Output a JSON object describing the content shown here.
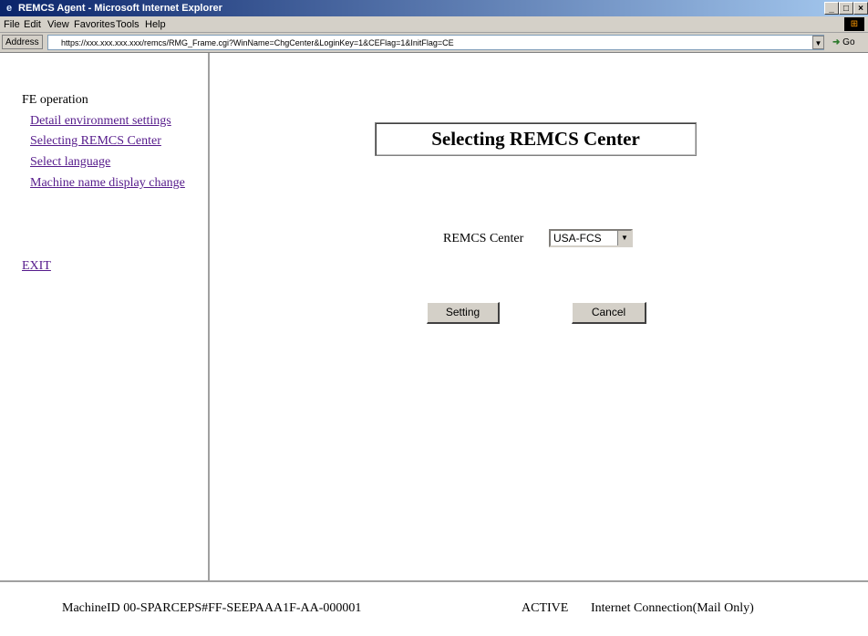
{
  "window": {
    "title": "REMCS Agent - Microsoft Internet Explorer",
    "icon": "ie-icon",
    "minimize": "_",
    "maximize": "□",
    "close": "×"
  },
  "menu": [
    "File",
    "Edit",
    "View",
    "Favorites",
    "Tools",
    "Help"
  ],
  "address": {
    "label": "Address",
    "url": "https://xxx.xxx.xxx.xxx/remcs/RMG_Frame.cgi?WinName=ChgCenter&LoginKey=1&CEFlag=1&InitFlag=CE",
    "go": "Go"
  },
  "sidebar": {
    "heading": "FE operation",
    "links": [
      "Detail environment settings",
      "Selecting REMCS Center",
      "Select language",
      "Machine name display change"
    ],
    "exit": "EXIT"
  },
  "main": {
    "title": "Selecting REMCS Center",
    "field_label": "REMCS Center",
    "select_value": "USA-FCS",
    "setting_button": "Setting",
    "cancel_button": "Cancel"
  },
  "status": {
    "machine": "MachineID  00-SPARCEPS#FF-SEEPAAA1F-AA-000001",
    "state": "ACTIVE",
    "connection": "Internet Connection(Mail Only)"
  },
  "colors": {
    "link": "#551a8b",
    "chrome": "#d4d0c8",
    "titlebar": "#0a246a"
  }
}
